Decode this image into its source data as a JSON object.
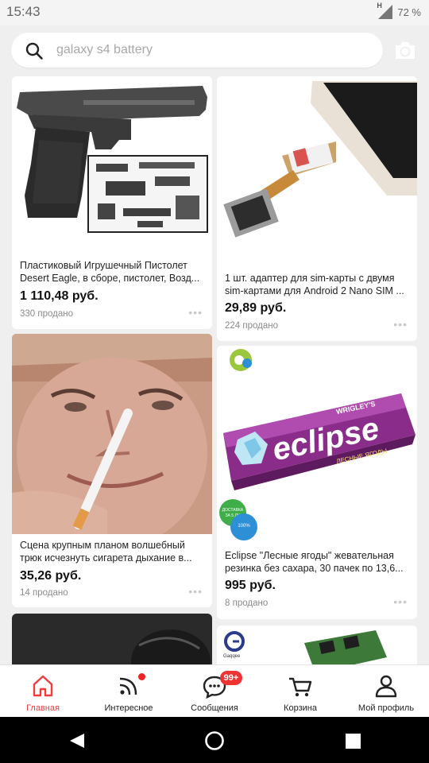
{
  "status": {
    "time": "15:43",
    "network": "H",
    "battery": "72 %"
  },
  "search": {
    "placeholder": "galaxy s4 battery"
  },
  "products": [
    {
      "title": "Пластиковый Игрушечный Пистолет Desert Eagle, в сборе, пистолет, Возд...",
      "price": "1 110,48 руб.",
      "sold": "330 продано",
      "image": "toy-pistol-image"
    },
    {
      "title": "1 шт. адаптер для sim-карты с двумя sim-картами для Android 2 Nano SIM ...",
      "price": "29,89 руб.",
      "sold": "224 продано",
      "image": "sim-adapter-image"
    },
    {
      "title": "Сцена крупным планом волшебный трюк исчезнуть сигарета дыхание в...",
      "price": "35,26 руб.",
      "sold": "14 продано",
      "image": "magic-cigarette-image"
    },
    {
      "title": "Eclipse \"Лесные ягоды\" жевательная резинка без сахара, 30 пачек по 13,6...",
      "price": "995 руб.",
      "sold": "8 продано",
      "image": "eclipse-gum-image"
    }
  ],
  "gum_pack": {
    "brand": "eclipse",
    "maker": "WRIGLEY'S",
    "flavor": "ЛЕСНЫЕ ЯГОДЫ"
  },
  "gum_badges": {
    "delivery_line1": "ДОСТАВКА",
    "delivery_line2": "ЗА 5 ДН",
    "original": "100%"
  },
  "partial_brand": "Gaqqee",
  "nav": [
    {
      "label": "Главная",
      "icon": "home-icon",
      "active": true
    },
    {
      "label": "Интересное",
      "icon": "feed-icon"
    },
    {
      "label": "Сообщения",
      "icon": "messages-icon",
      "badge": "99+"
    },
    {
      "label": "Корзина",
      "icon": "cart-icon"
    },
    {
      "label": "Мой профиль",
      "icon": "profile-icon"
    }
  ],
  "colors": {
    "accent": "#f03c3c",
    "badge": "#ee3333"
  }
}
